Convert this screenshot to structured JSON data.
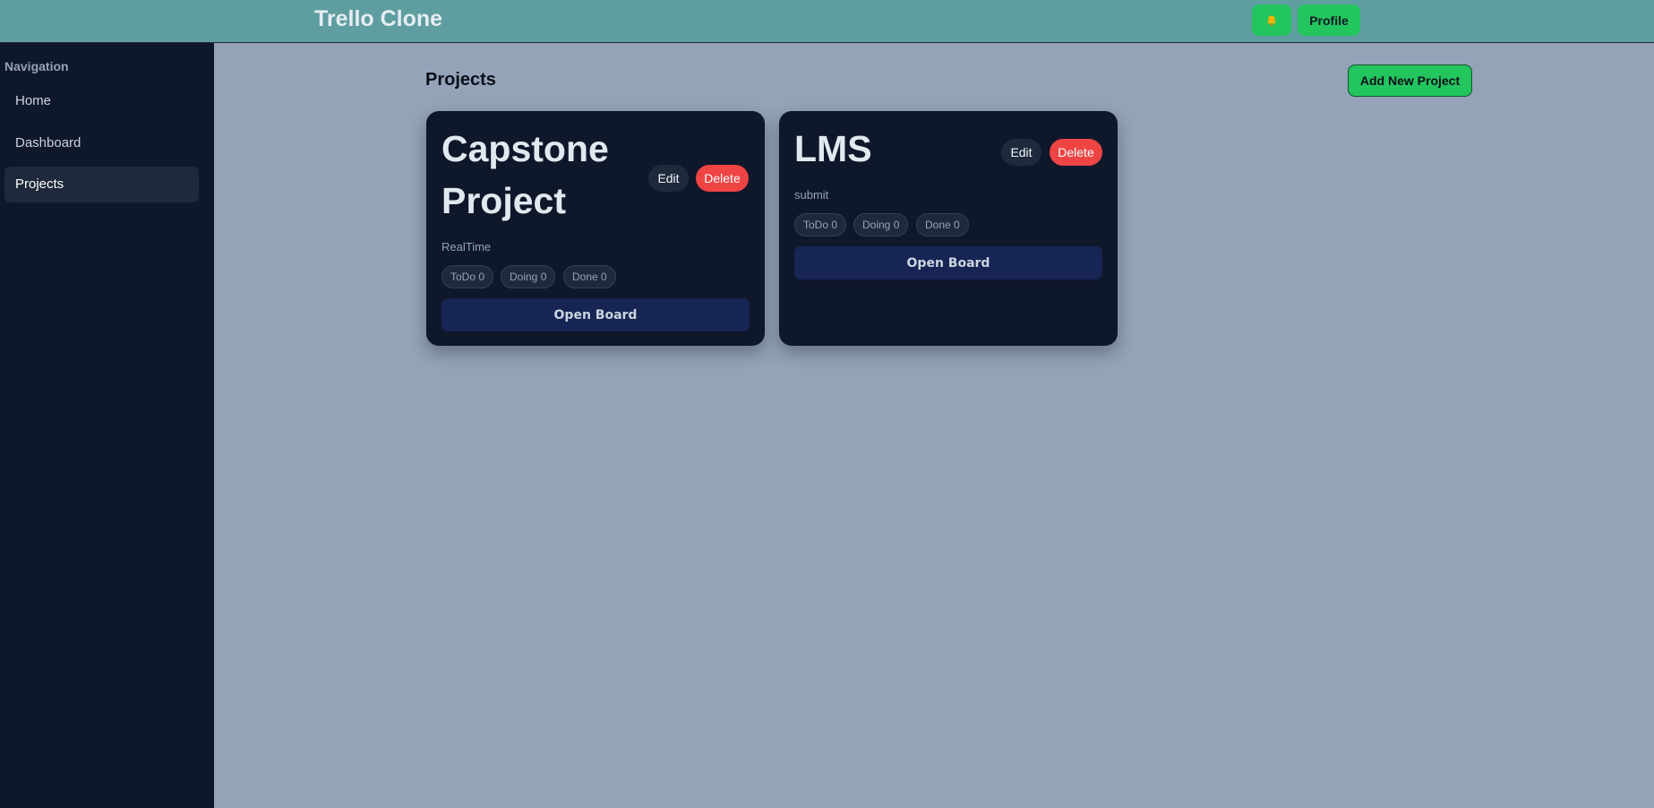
{
  "app": {
    "title": "Trello Clone"
  },
  "header": {
    "notification_icon": "bell-icon",
    "profile_label": "Profile"
  },
  "sidebar": {
    "heading": "Navigation",
    "items": [
      {
        "label": "Home",
        "active": false
      },
      {
        "label": "Dashboard",
        "active": false
      },
      {
        "label": "Projects",
        "active": true
      }
    ]
  },
  "main": {
    "title": "Projects",
    "add_button_label": "Add New Project",
    "projects": [
      {
        "name_line1": "Capstone",
        "name_line2": "Project",
        "description": "RealTime",
        "edit_label": "Edit",
        "delete_label": "Delete",
        "counts": [
          "ToDo 0",
          "Doing 0",
          "Done 0"
        ],
        "open_label": "Open Board"
      },
      {
        "name_line1": "LMS",
        "description": "submit",
        "edit_label": "Edit",
        "delete_label": "Delete",
        "counts": [
          "ToDo 0",
          "Doing 0",
          "Done 0"
        ],
        "open_label": "Open Board"
      }
    ]
  },
  "colors": {
    "topbar": "#5f9ea0",
    "sidebar": "#0f172a",
    "page_background": "#94a3b8",
    "accent_green": "#22c55e",
    "danger_red": "#ef4444",
    "card": "#0f172a"
  }
}
